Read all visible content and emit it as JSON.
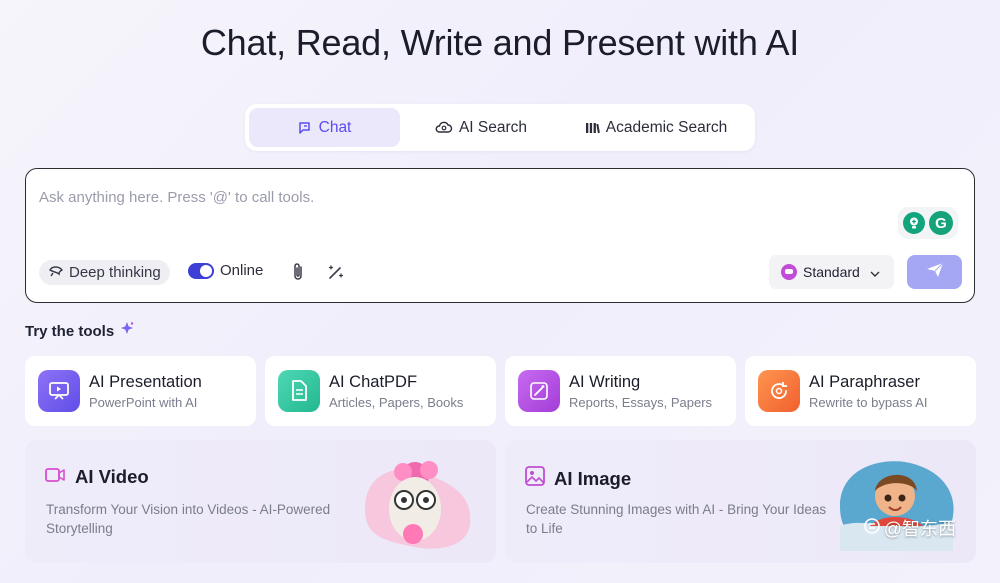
{
  "hero": {
    "title": "Chat, Read, Write and Present with AI"
  },
  "tabs": [
    {
      "label": "Chat",
      "icon": "chat-icon",
      "active": true
    },
    {
      "label": "AI Search",
      "icon": "cloud-search-icon",
      "active": false
    },
    {
      "label": "Academic Search",
      "icon": "library-icon",
      "active": false
    }
  ],
  "composer": {
    "placeholder": "Ask anything here. Press '@' to call tools.",
    "deep_thinking_label": "Deep thinking",
    "online_label": "Online",
    "online_enabled": true,
    "model_select": "Standard",
    "accent_color": "#a5a6f4"
  },
  "tools_section": {
    "title": "Try the tools"
  },
  "tools": [
    {
      "name": "AI Presentation",
      "sub": "PowerPoint with AI",
      "icon": "presentation-icon",
      "color": "#7b62f0"
    },
    {
      "name": "AI ChatPDF",
      "sub": "Articles, Papers, Books",
      "icon": "document-icon",
      "color": "#2fc6a1"
    },
    {
      "name": "AI Writing",
      "sub": "Reports, Essays, Papers",
      "icon": "pen-sparkle-icon",
      "color": "#b64fe0"
    },
    {
      "name": "AI Paraphraser",
      "sub": "Rewrite to bypass AI",
      "icon": "rewrite-icon",
      "color": "#f6783f"
    }
  ],
  "features": [
    {
      "title": "AI Video",
      "desc": "Transform Your Vision into Videos - AI-Powered Storytelling",
      "icon": "video-icon"
    },
    {
      "title": "AI Image",
      "desc": "Create Stunning Images with AI - Bring Your Ideas to Life",
      "icon": "image-icon"
    }
  ],
  "watermark": {
    "text": "@智东西"
  }
}
